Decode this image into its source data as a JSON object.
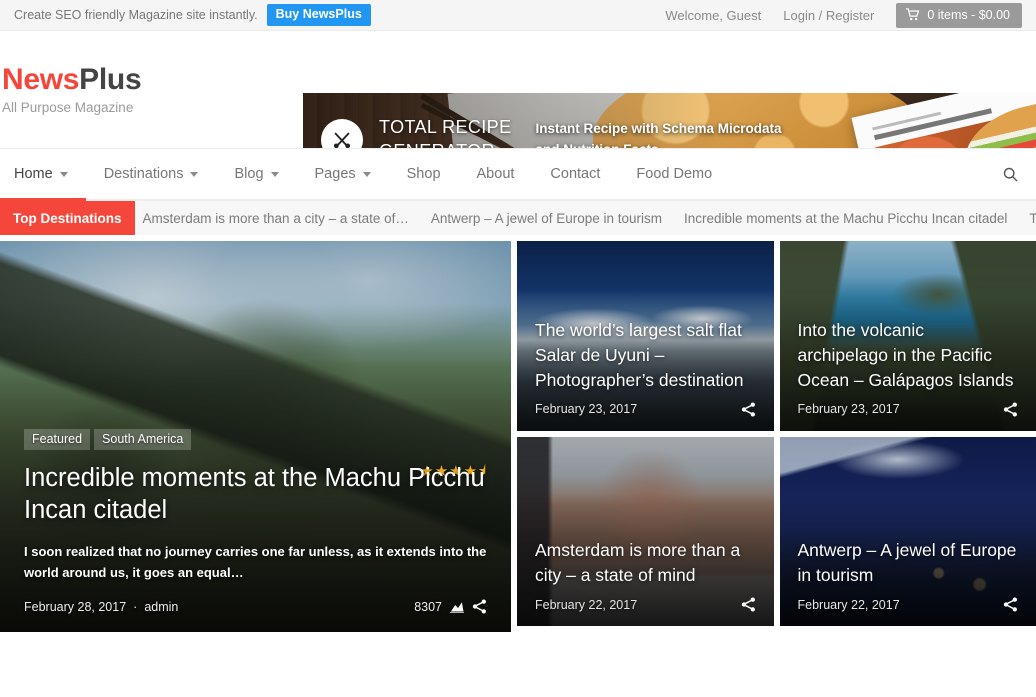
{
  "topbar": {
    "promo_text": "Create SEO friendly Magazine site instantly.",
    "buy_button": "Buy NewsPlus",
    "welcome": "Welcome, Guest",
    "login_register": "Login / Register",
    "cart_text": "0 items - $0.00",
    "cart_icon": "shopping-cart-icon",
    "accent_blue": "#2196f3"
  },
  "brand": {
    "name_first": "News",
    "name_second": "Plus",
    "tagline": "All Purpose Magazine",
    "accent_red": "#f4463b"
  },
  "banner": {
    "icon": "fork-knife-icon",
    "title": "TOTAL RECIPE\nGENERATOR",
    "subtitle": "Instant Recipe with Schema Microdata\nand Nutrition Facts"
  },
  "nav": {
    "items": [
      {
        "label": "Home",
        "has_dropdown": true,
        "active": true
      },
      {
        "label": "Destinations",
        "has_dropdown": true,
        "active": false
      },
      {
        "label": "Blog",
        "has_dropdown": true,
        "active": false
      },
      {
        "label": "Pages",
        "has_dropdown": true,
        "active": false
      },
      {
        "label": "Shop",
        "has_dropdown": false,
        "active": false
      },
      {
        "label": "About",
        "has_dropdown": false,
        "active": false
      },
      {
        "label": "Contact",
        "has_dropdown": false,
        "active": false
      },
      {
        "label": "Food Demo",
        "has_dropdown": false,
        "active": false
      }
    ],
    "search_icon": "search-icon"
  },
  "ticker": {
    "label": "Top Destinations",
    "items": [
      "Amsterdam is more than a city – a state of…",
      "Antwerp – A jewel of Europe in tourism",
      "Incredible moments at the Machu Picchu Incan citadel",
      "Th"
    ]
  },
  "hero": {
    "badges": [
      "Featured",
      "South America"
    ],
    "rating": 4.5,
    "rating_stars": "★★★★⯨",
    "title": "Incredible moments at the Machu Picchu Incan citadel",
    "excerpt": "I soon realized that no journey carries one far unless, as it extends into the world around us, it goes an equal…",
    "date": "February 28, 2017",
    "separator": "·",
    "author": "admin",
    "views": "8307",
    "views_icon": "stats-icon",
    "share_icon": "share-icon"
  },
  "cards": [
    {
      "title": "The world’s largest salt flat Salar de Uyuni – Photographer’s destination",
      "date": "February 23, 2017",
      "share_icon": "share-icon",
      "photo": "photo-salar"
    },
    {
      "title": "Into the volcanic archipelago in the Pacific Ocean – Galápagos Islands",
      "date": "February 23, 2017",
      "share_icon": "share-icon",
      "photo": "photo-galapagos"
    },
    {
      "title": "Amsterdam is more than a city – a state of mind",
      "date": "February 22, 2017",
      "share_icon": "share-icon",
      "photo": "photo-amsterdam"
    },
    {
      "title": "Antwerp – A jewel of Europe in tourism",
      "date": "February 22, 2017",
      "share_icon": "share-icon",
      "photo": "photo-antwerp"
    }
  ]
}
